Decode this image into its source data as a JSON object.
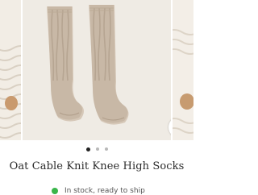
{
  "product": {
    "title": "Oat Cable Knit Knee High Socks",
    "stock_status": "In stock, ready to ship"
  },
  "carousel": {
    "slide_count": 3,
    "active_index": 0,
    "zoom_icon": "magnifier-icon"
  },
  "colors": {
    "sock": "#c8b8a6",
    "background": "#efebe4",
    "stock_indicator": "#39b54a"
  }
}
